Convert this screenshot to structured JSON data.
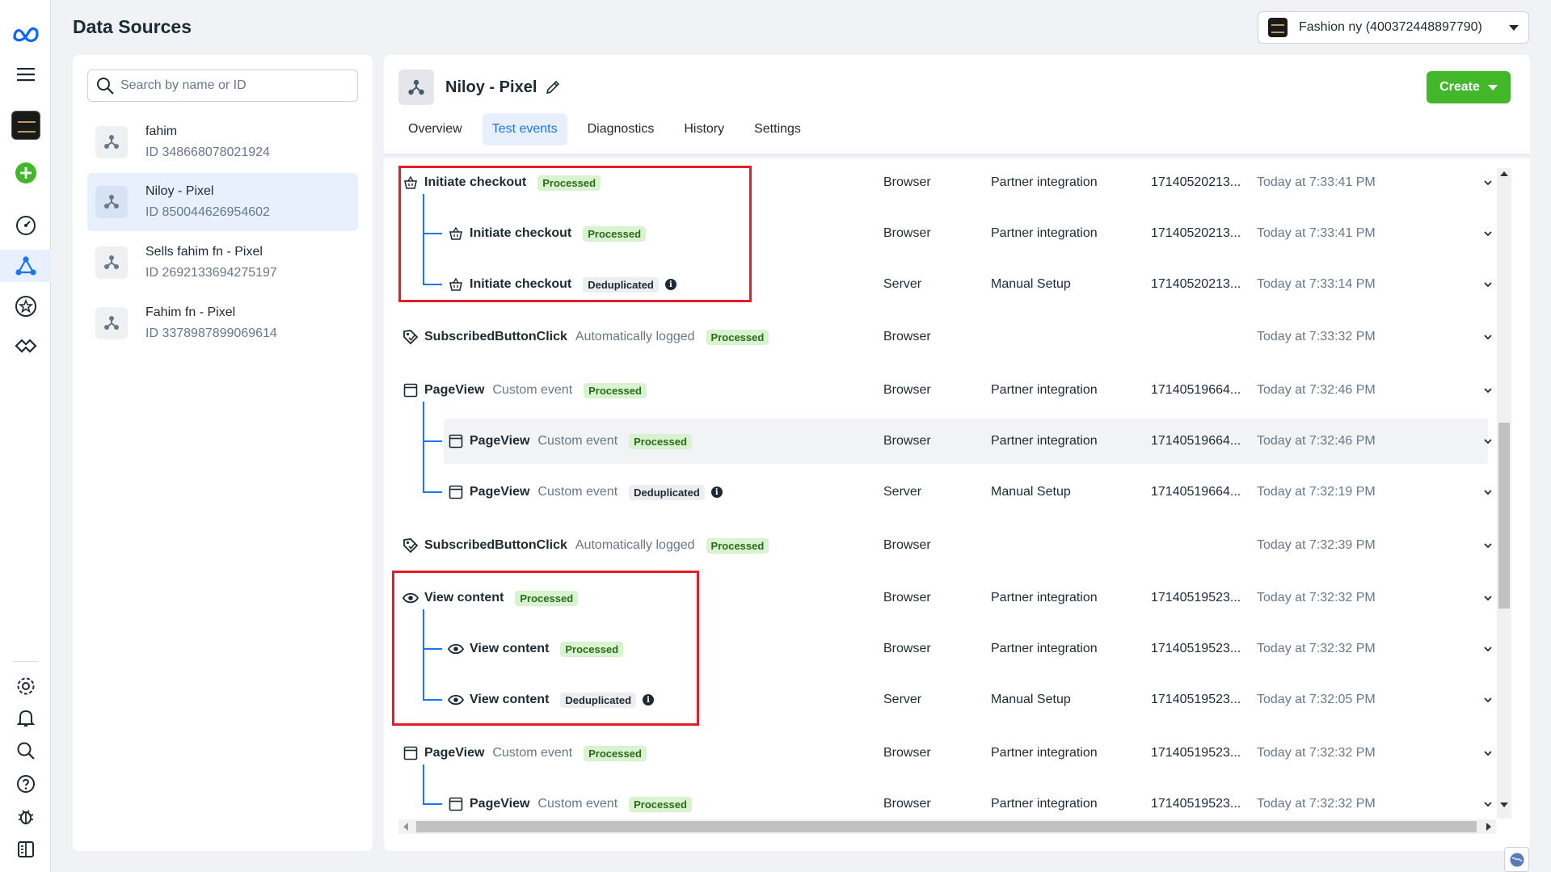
{
  "header": {
    "title": "Data Sources",
    "account_selector": "Fashion ny (400372448897790)"
  },
  "rail": {
    "icons": [
      "meta-logo-icon",
      "menu-icon",
      "account-avatar-icon",
      "add-icon",
      "dashboard-icon",
      "data-sources-icon",
      "star-icon",
      "partnership-icon",
      "settings-icon",
      "bell-icon",
      "search-icon",
      "help-icon",
      "bug-icon",
      "panel-toggle-icon"
    ]
  },
  "sources": {
    "search_placeholder": "Search by name or ID",
    "items": [
      {
        "name": "fahim",
        "id": "ID 348668078021924"
      },
      {
        "name": "Niloy - Pixel",
        "id": "ID 850044626954602"
      },
      {
        "name": "Sells fahim fn - Pixel",
        "id": "ID 2692133694275197"
      },
      {
        "name": "Fahim fn - Pixel",
        "id": "ID 3378987899069614"
      }
    ]
  },
  "pixel": {
    "name": "Niloy - Pixel",
    "create_label": "Create",
    "tabs": [
      "Overview",
      "Test events",
      "Diagnostics",
      "History",
      "Settings"
    ]
  },
  "events": [
    {
      "name": "Initiate checkout",
      "sub": "",
      "badge": "Processed",
      "source": "Browser",
      "setup": "Partner integration",
      "event_id": "17140520213...",
      "time": "Today at 7:33:41 PM"
    },
    {
      "name": "Initiate checkout",
      "sub": "",
      "badge": "Processed",
      "source": "Browser",
      "setup": "Partner integration",
      "event_id": "17140520213...",
      "time": "Today at 7:33:41 PM"
    },
    {
      "name": "Initiate checkout",
      "sub": "",
      "badge": "Deduplicated",
      "source": "Server",
      "setup": "Manual Setup",
      "event_id": "17140520213...",
      "time": "Today at 7:33:14 PM"
    },
    {
      "name": "SubscribedButtonClick",
      "sub": "Automatically logged",
      "badge": "Processed",
      "source": "Browser",
      "setup": "",
      "event_id": "",
      "time": "Today at 7:33:32 PM"
    },
    {
      "name": "PageView",
      "sub": "Custom event",
      "badge": "Processed",
      "source": "Browser",
      "setup": "Partner integration",
      "event_id": "17140519664...",
      "time": "Today at 7:32:46 PM"
    },
    {
      "name": "PageView",
      "sub": "Custom event",
      "badge": "Processed",
      "source": "Browser",
      "setup": "Partner integration",
      "event_id": "17140519664...",
      "time": "Today at 7:32:46 PM"
    },
    {
      "name": "PageView",
      "sub": "Custom event",
      "badge": "Deduplicated",
      "source": "Server",
      "setup": "Manual Setup",
      "event_id": "17140519664...",
      "time": "Today at 7:32:19 PM"
    },
    {
      "name": "SubscribedButtonClick",
      "sub": "Automatically logged",
      "badge": "Processed",
      "source": "Browser",
      "setup": "",
      "event_id": "",
      "time": "Today at 7:32:39 PM"
    },
    {
      "name": "View content",
      "sub": "",
      "badge": "Processed",
      "source": "Browser",
      "setup": "Partner integration",
      "event_id": "17140519523...",
      "time": "Today at 7:32:32 PM"
    },
    {
      "name": "View content",
      "sub": "",
      "badge": "Processed",
      "source": "Browser",
      "setup": "Partner integration",
      "event_id": "17140519523...",
      "time": "Today at 7:32:32 PM"
    },
    {
      "name": "View content",
      "sub": "",
      "badge": "Deduplicated",
      "source": "Server",
      "setup": "Manual Setup",
      "event_id": "17140519523...",
      "time": "Today at 7:32:05 PM"
    },
    {
      "name": "PageView",
      "sub": "Custom event",
      "badge": "Processed",
      "source": "Browser",
      "setup": "Partner integration",
      "event_id": "17140519523...",
      "time": "Today at 7:32:32 PM"
    },
    {
      "name": "PageView",
      "sub": "Custom event",
      "badge": "Processed",
      "source": "Browser",
      "setup": "Partner integration",
      "event_id": "17140519523...",
      "time": "Today at 7:32:32 PM"
    }
  ],
  "colors": {
    "accent": "#1876f2",
    "create": "#42b72a",
    "processed_bg": "#d9f2d0",
    "annotation_red": "#e41e26"
  }
}
